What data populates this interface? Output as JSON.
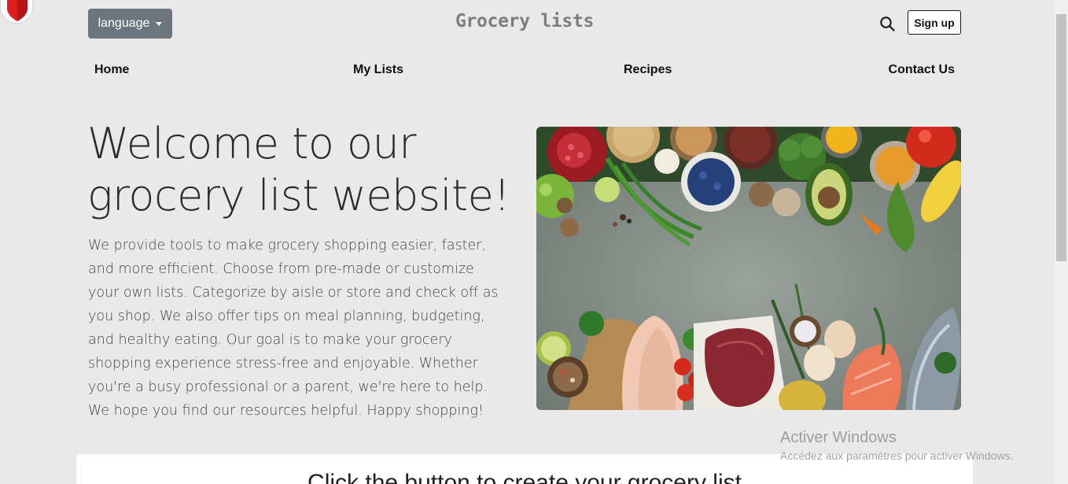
{
  "header": {
    "language_label": "language",
    "site_title": "Grocery lists",
    "signup_label": "Sign up",
    "search_icon": "search-icon"
  },
  "nav": {
    "items": [
      {
        "label": "Home"
      },
      {
        "label": "My Lists"
      },
      {
        "label": "Recipes"
      },
      {
        "label": "Contact Us"
      }
    ]
  },
  "hero": {
    "title": "Welcome to our grocery list website!",
    "text": "We provide tools to make grocery shopping easier, faster, and more efficient. Choose from pre-made or customize your own lists. Categorize by aisle or store and check off as you shop. We also offer tips on meal planning, budgeting, and healthy eating. Our goal is to make your grocery shopping experience stress-free and enjoyable. Whether you're a busy professional or a parent, we're here to help. We hope you find our resources helpful. Happy shopping!",
    "image_icon": "fresh-vegetables-image"
  },
  "cta": {
    "title": "Click the button to create your grocery list"
  },
  "watermark": {
    "title": "Activer Windows",
    "subtitle": "Accédez aux paramètres pour activer Windows."
  },
  "colors": {
    "background": "#e9e9e9",
    "language_button": "#6c757d",
    "title_gray": "#7d7d7d",
    "shield_red": "#e01e1e"
  }
}
